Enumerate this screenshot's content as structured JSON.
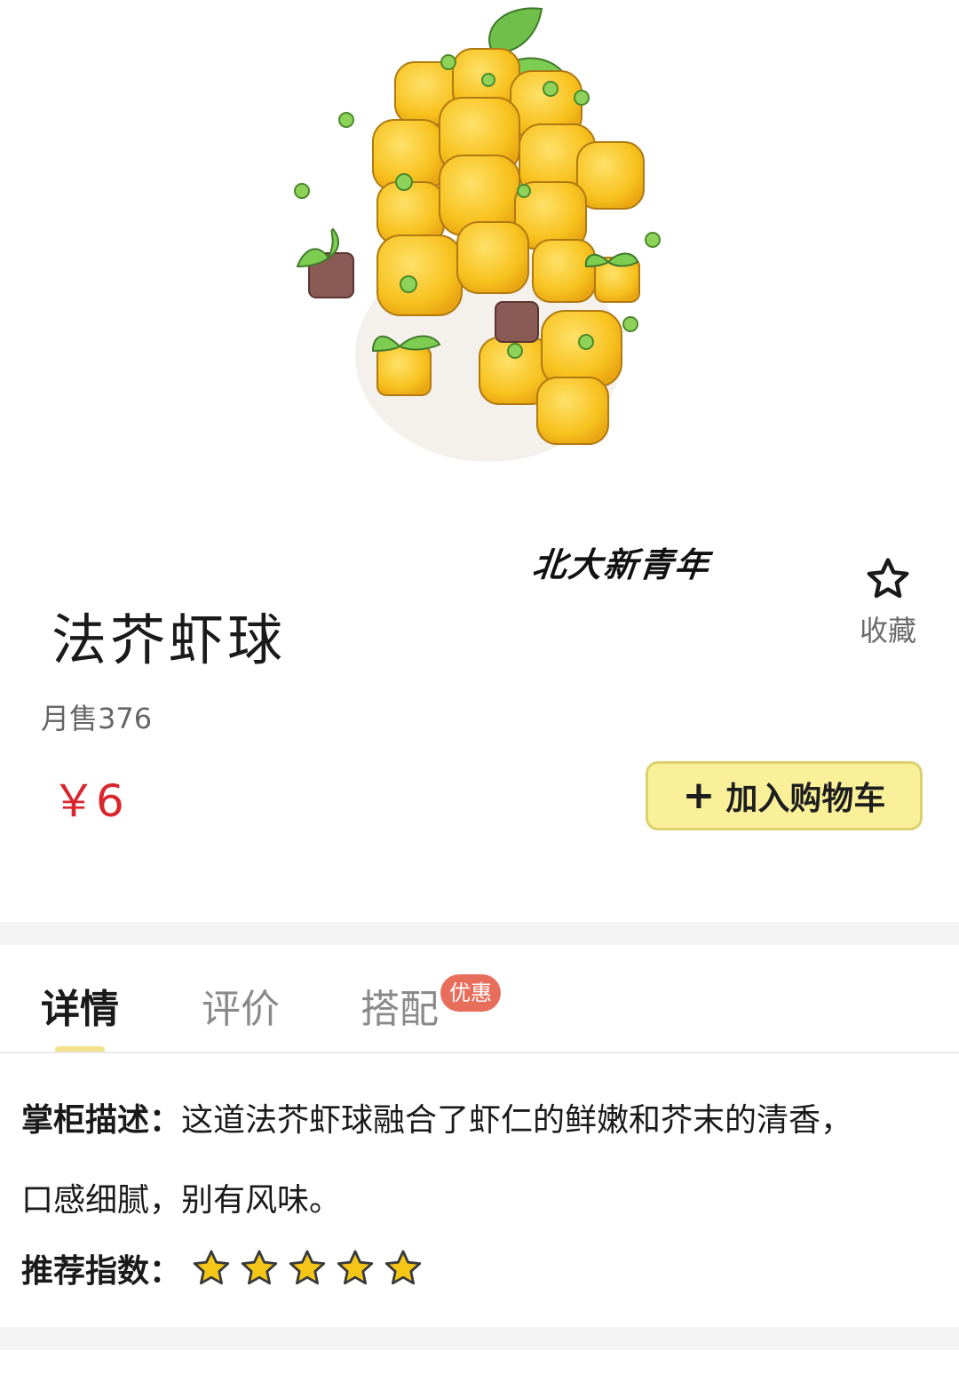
{
  "watermark": "北大新青年",
  "dish": {
    "name": "法芥虾球",
    "monthly_sales": "月售376",
    "price": "￥6"
  },
  "favorite": {
    "label": "收藏",
    "icon": "star-outline-icon"
  },
  "cart": {
    "label": "加入购物车",
    "icon": "plus-icon",
    "bg_color": "#fbf09a"
  },
  "tabs": [
    {
      "label": "详情",
      "active": true
    },
    {
      "label": "评价",
      "active": false
    },
    {
      "label": "搭配",
      "active": false,
      "badge": "优惠"
    }
  ],
  "description": {
    "label": "掌柜描述：",
    "line1": "这道法芥虾球融合了虾仁的鲜嫩和芥末的清香，",
    "line2": "口感细腻，别有风味。"
  },
  "rating": {
    "label": "推荐指数：",
    "stars": 5,
    "max": 5,
    "star_color": "#f5c518"
  },
  "colors": {
    "price": "#d8262d",
    "accent": "#fbf09a",
    "badge": "#e86e5c"
  }
}
